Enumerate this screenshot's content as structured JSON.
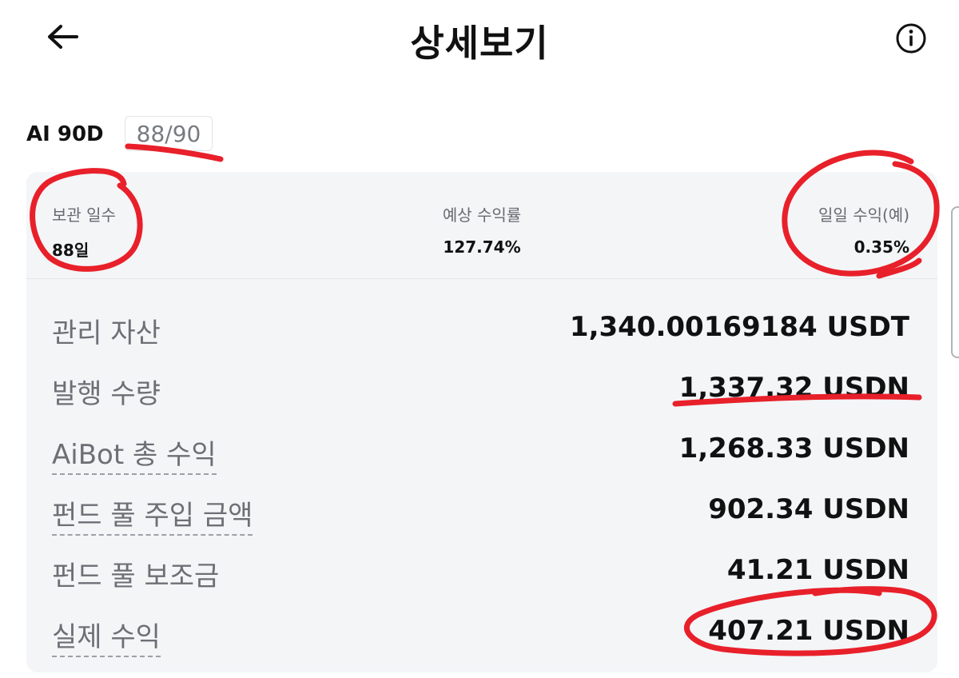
{
  "header": {
    "title": "상세보기",
    "back_icon": "arrow-left-icon",
    "info_icon": "info-circle-icon"
  },
  "product": {
    "name": "AI 90D",
    "progress": "88/90"
  },
  "stats": {
    "holding_days": {
      "label": "보관 일수",
      "value": "88일"
    },
    "expected_return": {
      "label": "예상 수익률",
      "value": "127.74%"
    },
    "daily_return": {
      "label": "일일 수익(예)",
      "value": "0.35%"
    }
  },
  "details": [
    {
      "label": "관리 자산",
      "value": "1,340.00169184 USDT",
      "dashed": false
    },
    {
      "label": "발행 수량",
      "value": "1,337.32 USDN",
      "dashed": false
    },
    {
      "label": "AiBot 총 수익",
      "value": "1,268.33 USDN",
      "dashed": true
    },
    {
      "label": "펀드 풀 주입 금액",
      "value": "902.34 USDN",
      "dashed": true
    },
    {
      "label": "펀드 풀 보조금",
      "value": "41.21 USDN",
      "dashed": false
    },
    {
      "label": "실제 수익",
      "value": "407.21 USDN",
      "dashed": true
    }
  ],
  "colors": {
    "accent_marker": "#e8202a",
    "card_background": "#f3f5f7",
    "label_gray": "#6c7075"
  }
}
